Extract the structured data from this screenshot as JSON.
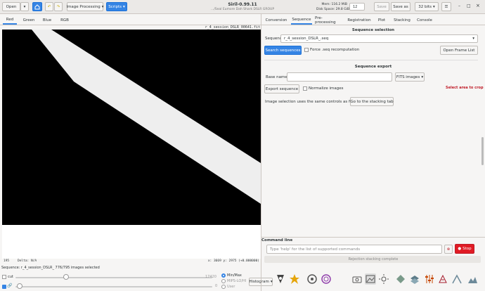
{
  "header": {
    "title": "Siril-0.99.11",
    "subtitle": ".../Seal Eumore Dah Shark DSLR GROUP",
    "open_label": "Open",
    "image_processing_label": "Image Processing",
    "scripts_label": "Scripts",
    "mem_label": "Mem: 116.2 MiB",
    "disk_label": "Disk Space: 29.8 GiB",
    "cpu_value": "12",
    "save_label": "Save",
    "save_as_label": "Save as",
    "bits_label": "32 bits"
  },
  "left_tabs": [
    "Red",
    "Green",
    "Blue",
    "RGB"
  ],
  "image_view": {
    "filename": "r_4_session_DSLR_00641.fit",
    "status_left": "195",
    "status_delta": "Delta: N/A",
    "status_coords": "x: 3669 y: 2975 (+0.000000)"
  },
  "bottom": {
    "sequence_info": "Sequence: r_4_session_DSLR_  776/795 images selected",
    "cut_label": "cut",
    "slider_high_value": "17420",
    "slider_low_value": "0",
    "radio_minmax": "Min/Max",
    "radio_mips": "MIPS-LO/HI",
    "radio_user": "User",
    "histogram_label": "Histogram"
  },
  "right_tabs": [
    "Conversion",
    "Sequence",
    "Pre-processing",
    "Registration",
    "Plot",
    "Stacking",
    "Console"
  ],
  "sequence_panel": {
    "selection_title": "Sequence selection",
    "sequence_label": "Sequence:",
    "sequence_value": "r_4_session_DSLR_.seq",
    "search_button": "Search sequences",
    "force_label": "Force .seq recomputation",
    "open_frame_list": "Open Frame List",
    "export_title": "Sequence export",
    "base_name_label": "Base name:",
    "base_name_value": "",
    "format_value": "FITS images",
    "select_area_note": "Select area to crop",
    "export_button": "Export sequence",
    "normalize_label": "Normalize images",
    "selection_info": "Image selection uses the same controls as for stacking",
    "goto_stacking": "Go to the stacking tab"
  },
  "command_line": {
    "title": "Command line",
    "placeholder": "Type 'help' for the list of supported commands",
    "stop_label": "Stop",
    "status_text": "Rejection stacking complete"
  },
  "colors": {
    "accent": "#3584e4",
    "stop": "#e01b24",
    "warn_text": "#c01c28"
  },
  "toolbar_icons": [
    "astrometry-icon",
    "photometry-icon",
    "psf-icon",
    "star-icon",
    "camera-icon",
    "image-icon",
    "sun-icon",
    "rect-icon",
    "folder-icon",
    "layers-icon",
    "mountain-icon",
    "diamond-icon",
    "sliders-icon",
    "triangle-icon",
    "palette-icon"
  ]
}
